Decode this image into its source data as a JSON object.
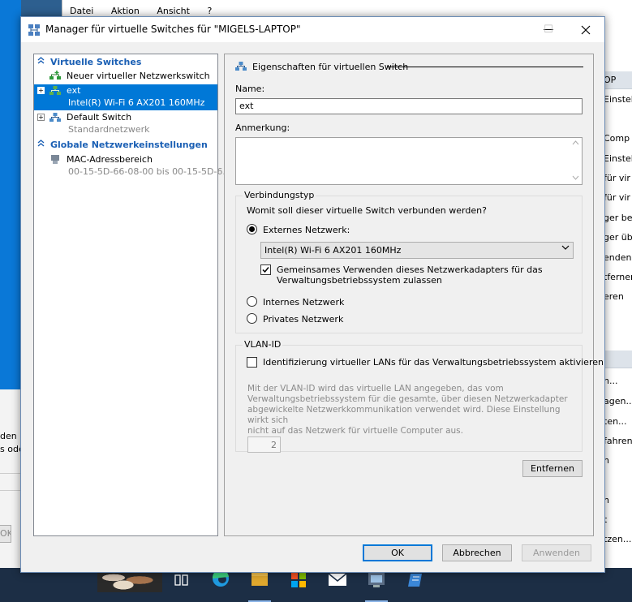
{
  "background": {
    "menu": [
      "Datei",
      "Aktion",
      "Ansicht",
      "?"
    ],
    "left_text": [
      "den N",
      "s ode"
    ],
    "left_ok": "OK",
    "right_header1": "OP",
    "right_items1": [
      "Einstellun",
      "Comp",
      "Einstel",
      "für vir",
      "für vir",
      "ger bea",
      "ger übe",
      "enden",
      "tferner",
      "eren"
    ],
    "right_items2": [
      "n...",
      "agen...",
      "ten...",
      "fahren",
      "n",
      "n",
      "t",
      "tzen..."
    ]
  },
  "dialog": {
    "title": "Manager für virtuelle Switches für \"MIGELS-LAPTOP\"",
    "min_glyph": "—",
    "max_glyph": "☐",
    "close_glyph": "✕"
  },
  "tree": {
    "section1": "Virtuelle Switches",
    "new_switch": "Neuer virtueller Netzwerkswitch",
    "items": [
      {
        "name": "ext",
        "sub": "Intel(R) Wi-Fi 6 AX201 160MHz",
        "selected": true
      },
      {
        "name": "Default Switch",
        "sub": "Standardnetzwerk",
        "selected": false
      }
    ],
    "section2": "Globale Netzwerkeinstellungen",
    "mac": {
      "name": "MAC-Adressbereich",
      "sub": "00-15-5D-66-08-00 bis 00-15-5D-6..."
    }
  },
  "props": {
    "header": "Eigenschaften für virtuellen Switch",
    "name_label": "Name:",
    "name_value": "ext",
    "note_label": "Anmerkung:",
    "conn": {
      "title": "Verbindungstyp",
      "question": "Womit soll dieser virtuelle Switch verbunden werden?",
      "external": "Externes Netzwerk:",
      "adapter": "Intel(R) Wi-Fi 6 AX201 160MHz",
      "share_line1": "Gemeinsames Verwenden dieses Netzwerkadapters für das",
      "share_line2": "Verwaltungsbetriebssystem zulassen",
      "internal": "Internes Netzwerk",
      "private": "Privates Netzwerk",
      "selected": "external",
      "share_checked": true
    },
    "vlan": {
      "title": "VLAN-ID",
      "enable": "Identifizierung virtueller LANs für das Verwaltungsbetriebssystem aktivieren",
      "enable_checked": false,
      "desc_lines": [
        "Mit der VLAN-ID wird das virtuelle LAN angegeben, das vom",
        "Verwaltungsbetriebssystem für die gesamte, über diesen Netzwerkadapter",
        "abgewickelte Netzwerkkommunikation verwendet wird. Diese Einstellung wirkt sich",
        "nicht auf das Netzwerk für virtuelle Computer aus."
      ],
      "value": "2"
    },
    "remove": "Entfernen"
  },
  "buttons": {
    "ok": "OK",
    "cancel": "Abbrechen",
    "apply": "Anwenden"
  },
  "colors": {
    "selection": "#0078d7",
    "section_heading": "#1a5fb4",
    "taskbar": "#1c2e45"
  }
}
